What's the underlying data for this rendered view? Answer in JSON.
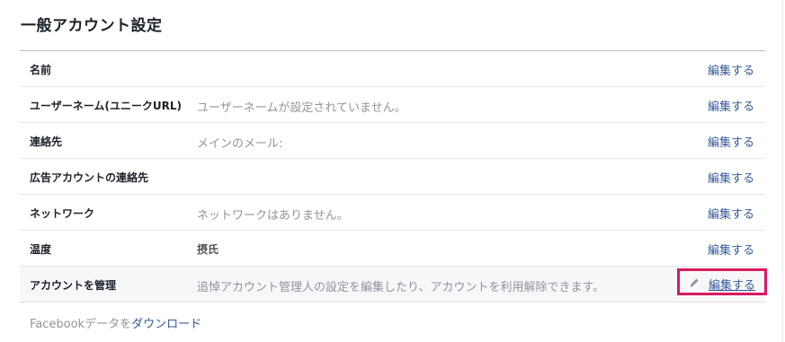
{
  "page": {
    "title": "一般アカウント設定"
  },
  "rows": [
    {
      "label": "名前",
      "value": "",
      "edit": "編集する"
    },
    {
      "label": "ユーザーネーム(ユニークURL)",
      "value": "ユーザーネームが設定されていません。",
      "edit": "編集する"
    },
    {
      "label": "連絡先",
      "value": "メインのメール:",
      "edit": "編集する"
    },
    {
      "label": "広告アカウントの連絡先",
      "value": "",
      "edit": "編集する"
    },
    {
      "label": "ネットワーク",
      "value": "ネットワークはありません。",
      "edit": "編集する"
    },
    {
      "label": "温度",
      "value": "摂氏",
      "edit": "編集する"
    },
    {
      "label": "アカウントを管理",
      "value": "追悼アカウント管理人の設定を編集したり、アカウントを利用解除できます。",
      "edit": "編集する"
    }
  ],
  "footer": {
    "prefix": "Facebookデータを",
    "link": "ダウンロード"
  },
  "colors": {
    "link": "#365899",
    "highlight_border": "#d81b60"
  },
  "icons": {
    "edit": "pencil-icon"
  }
}
